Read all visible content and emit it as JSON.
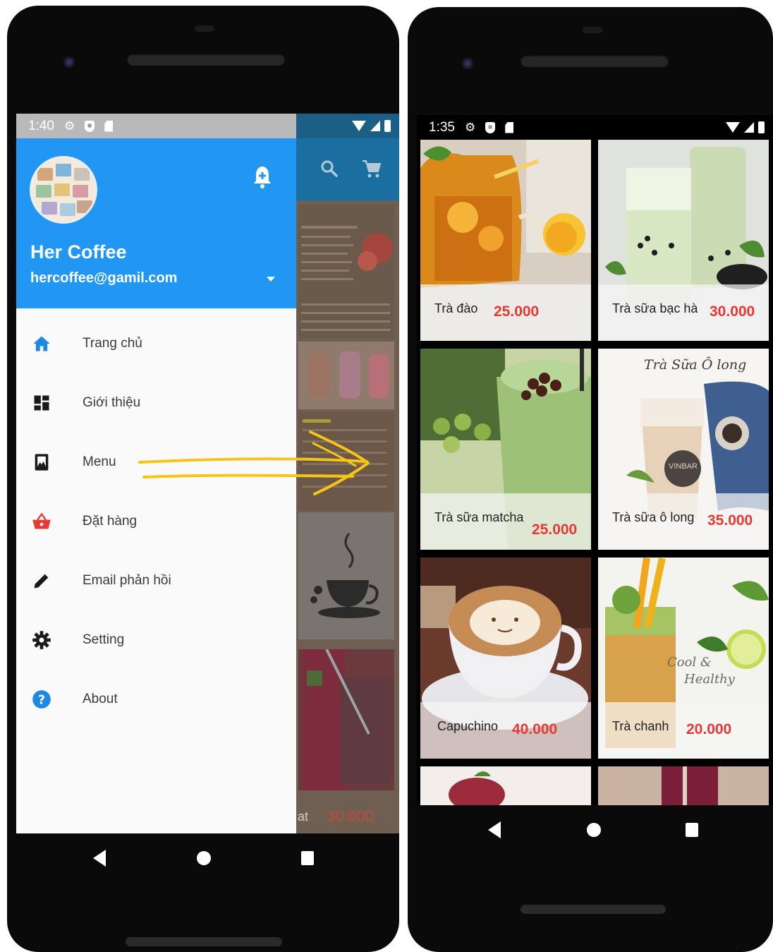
{
  "left_phone": {
    "status": {
      "time": "1:40"
    },
    "drawer": {
      "profile_name": "Her Coffee",
      "profile_email": "hercoffee@gamil.com",
      "menu_items": [
        {
          "label": "Trang chủ",
          "icon": "home-icon",
          "color": "#1e88e5"
        },
        {
          "label": "Giới thiệu",
          "icon": "dashboard-icon",
          "color": "#1a1a1a"
        },
        {
          "label": "Menu",
          "icon": "photo-book-icon",
          "color": "#1a1a1a"
        },
        {
          "label": "Đặt hàng",
          "icon": "basket-icon",
          "color": "#e53935"
        },
        {
          "label": "Email phản hồi",
          "icon": "pencil-icon",
          "color": "#1a1a1a"
        },
        {
          "label": "Setting",
          "icon": "gear-icon",
          "color": "#1a1a1a"
        },
        {
          "label": "About",
          "icon": "help-icon",
          "color": "#1e88e5"
        }
      ]
    },
    "behind": {
      "partial_name": "at",
      "partial_price": "30.000"
    }
  },
  "right_phone": {
    "status": {
      "time": "1:35"
    },
    "products": [
      {
        "name": "Trà đào",
        "price": "25.000"
      },
      {
        "name": "Trà sữa bạc hà",
        "price": "30.000"
      },
      {
        "name": "Trà sữa matcha",
        "price": "25.000"
      },
      {
        "name": "Trà sữa ô long",
        "price": "35.000"
      },
      {
        "name": "Capuchino",
        "price": "40.000"
      },
      {
        "name": "Trà chanh",
        "price": "20.000"
      }
    ],
    "image_texts": {
      "olong_title": "Trà Sữa Ô long",
      "olong_brand": "VINBAR",
      "chanh_slogan_1": "Cool &",
      "chanh_slogan_2": "Healthy"
    }
  },
  "colors": {
    "accent_blue": "#2196f3",
    "price_red": "#e53935",
    "arrow_yellow": "#f5c518"
  }
}
